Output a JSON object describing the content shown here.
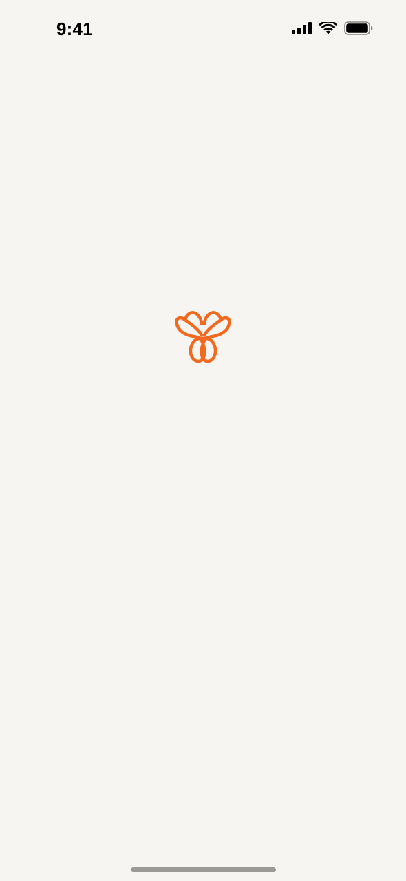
{
  "status_bar": {
    "time": "9:41",
    "icons": [
      "cellular-signal-icon",
      "wifi-icon",
      "battery-icon"
    ]
  },
  "splash": {
    "logo_icon": "butterfly-logo-icon",
    "accent_color": "#f26a1f"
  },
  "colors": {
    "background": "#f7f5f2",
    "home_indicator": "#9b9a98"
  }
}
